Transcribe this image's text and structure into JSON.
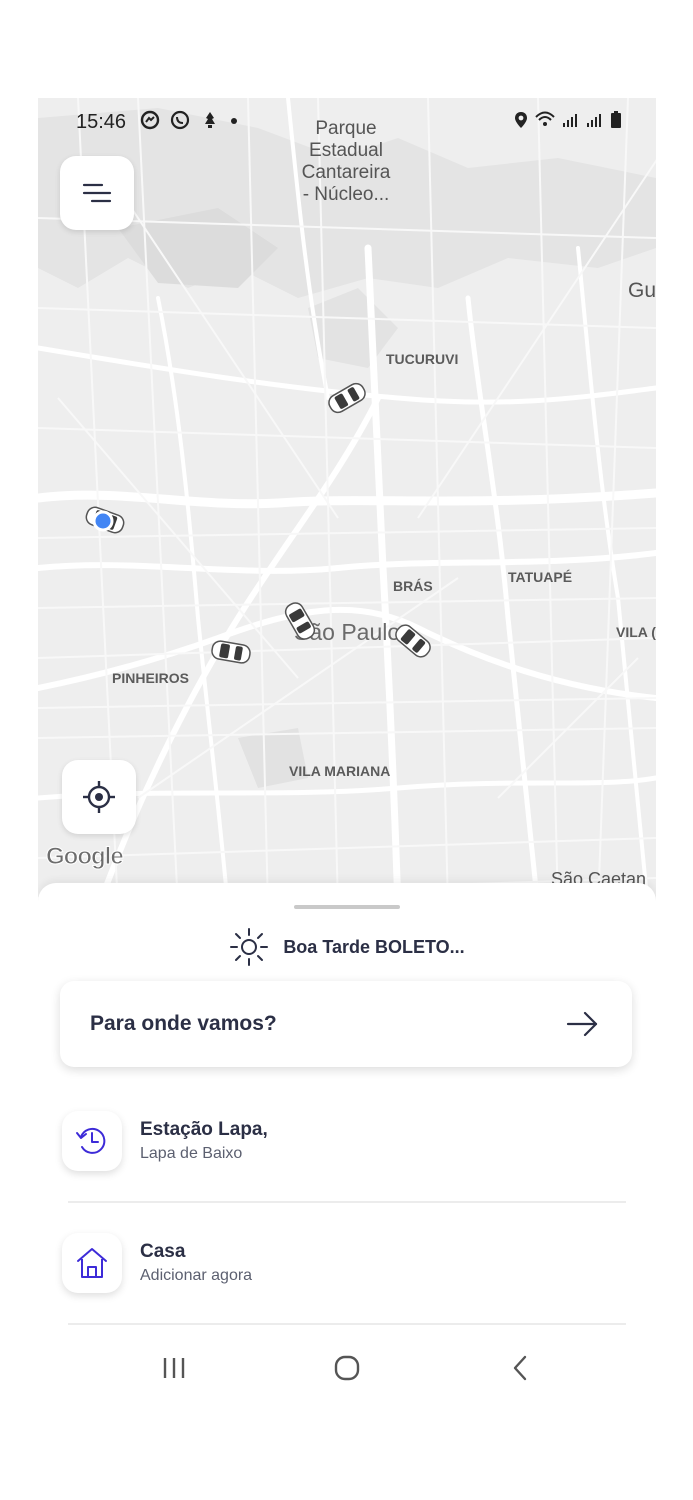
{
  "status_bar": {
    "time": "15:46",
    "left_icons": [
      "messenger-icon",
      "whatsapp-icon",
      "notification-icon",
      "dot-icon"
    ],
    "right_icons": [
      "location-icon",
      "wifi-icon",
      "signal-icon",
      "signal-icon",
      "battery-icon"
    ]
  },
  "map": {
    "labels": {
      "park": "Parque\nEstadual\nCantareira\n- Núcleo...",
      "gu": "Gu",
      "tucuruvi": "TUCURUVI",
      "bras": "BRÁS",
      "tatuape": "TATUAPÉ",
      "sao_paulo": "São Paulo",
      "vila": "VILA (",
      "pinheiros": "PINHEIROS",
      "vila_mariana": "VILA MARIANA",
      "sao_caetano": "São Caetan"
    },
    "attribution": "Google",
    "menu_icon": "menu-icon",
    "locate_icon": "my-location-icon",
    "car_icon": "car-icon",
    "user_marker": "user-location-marker"
  },
  "sheet": {
    "greeting": "Boa Tarde BOLETO...",
    "greeting_icon": "sun-icon",
    "search_prompt": "Para onde vamos?",
    "search_icon": "arrow-right-icon",
    "recent": {
      "title": "Estação Lapa,",
      "subtitle": "Lapa de Baixo",
      "icon": "history-icon"
    },
    "home": {
      "title": "Casa",
      "subtitle": "Adicionar agora",
      "icon": "home-icon"
    }
  },
  "nav_bar": {
    "recents": "recents-icon",
    "home": "home-circle-icon",
    "back": "back-icon"
  },
  "colors": {
    "accent": "#3d2bd8",
    "text_dark": "#2b2f45",
    "map_bg": "#eeeeee"
  }
}
